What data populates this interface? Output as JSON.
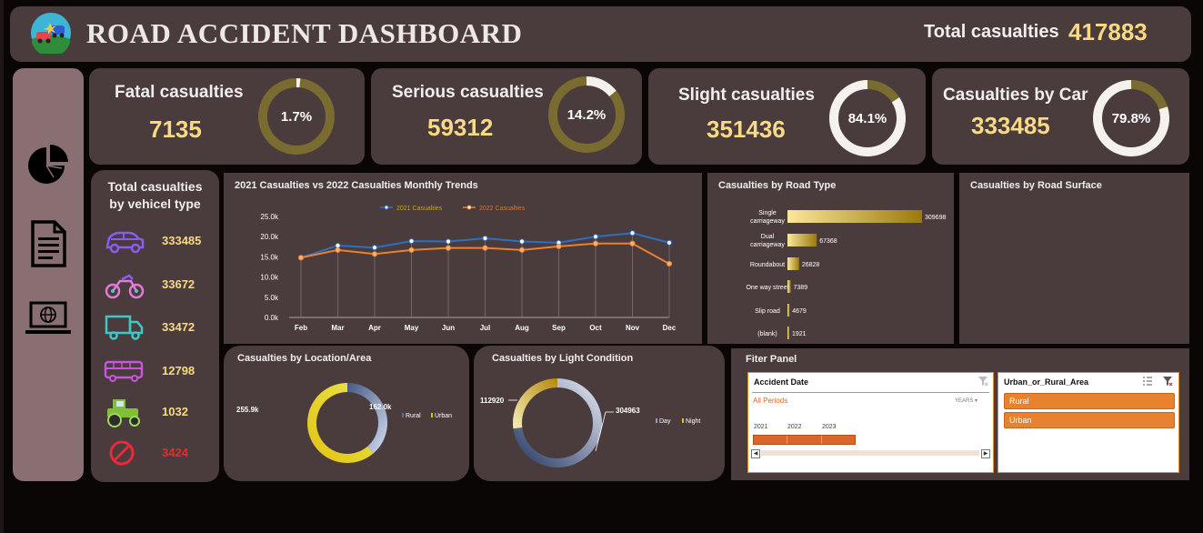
{
  "header": {
    "title": "ROAD ACCIDENT DASHBOARD",
    "total_label": "Total casualties",
    "total_value": "417883"
  },
  "sidebar": {
    "icons": [
      "pie-chart-icon",
      "document-icon",
      "laptop-globe-icon"
    ]
  },
  "kpis": [
    {
      "label": "Fatal casualties",
      "value": "7135",
      "pct_text": "1.7%",
      "pct": 1.7
    },
    {
      "label": "Serious casualties",
      "value": "59312",
      "pct_text": "14.2%",
      "pct": 14.2
    },
    {
      "label": "Slight casualties",
      "value": "351436",
      "pct_text": "84.1%",
      "pct": 84.1
    },
    {
      "label": "Casualties by Car",
      "value": "333485",
      "pct_text": "79.8%",
      "pct": 79.8
    }
  ],
  "vehicles": {
    "title_line1": "Total casualties",
    "title_line2": "by vehicel type",
    "items": [
      {
        "icon": "car-icon",
        "value": "333485"
      },
      {
        "icon": "motorcycle-icon",
        "value": "33672"
      },
      {
        "icon": "truck-icon",
        "value": "33472"
      },
      {
        "icon": "bus-icon",
        "value": "12798"
      },
      {
        "icon": "tractor-icon",
        "value": "1032"
      },
      {
        "icon": "prohibited-icon",
        "value": "3424"
      }
    ]
  },
  "trend": {
    "title": "2021 Casualties vs 2022 Casualties Monthly Trends"
  },
  "road_type": {
    "title": "Casualties by Road Type"
  },
  "road_surface": {
    "title": "Casualties by Road Surface"
  },
  "location": {
    "title": "Casualties by Location/Area"
  },
  "light": {
    "title": "Casualties by Light Condition"
  },
  "filter": {
    "title": "Fiter Panel",
    "date_slicer": {
      "header": "Accident Date",
      "all_periods": "All Periods",
      "years_label": "YEARS",
      "years": [
        "2021",
        "2022",
        "2023"
      ]
    },
    "area_slicer": {
      "header": "Urban_or_Rural_Area",
      "options": [
        "Rural",
        "Urban"
      ]
    }
  },
  "colors": {
    "panel": "#4a3b3d",
    "gold": "#f7d986",
    "ring": "#7a6c30",
    "line2021": "#2f6fbf",
    "line2022": "#e8822e",
    "orange": "#e8822e"
  },
  "chart_data": [
    {
      "type": "line",
      "title": "2021 Casualties vs 2022 Casualties Monthly Trends",
      "x": [
        "Feb",
        "Mar",
        "Apr",
        "May",
        "Jun",
        "Jul",
        "Aug",
        "Sep",
        "Oct",
        "Nov",
        "Dec"
      ],
      "ylim": [
        0,
        25000
      ],
      "yticks": [
        "0.0k",
        "5.0k",
        "10.0k",
        "15.0k",
        "20.0k",
        "25.0k"
      ],
      "grid": false,
      "legend": "top",
      "series": [
        {
          "name": "2021 Casualties",
          "values": [
            14800,
            17800,
            17300,
            18900,
            18800,
            19600,
            18800,
            18500,
            20000,
            20900,
            18500
          ]
        },
        {
          "name": "2022 Casualties",
          "values": [
            14800,
            16700,
            15700,
            16700,
            17200,
            17200,
            16700,
            17600,
            18300,
            18300,
            13300
          ]
        }
      ]
    },
    {
      "type": "bar",
      "orientation": "horizontal",
      "title": "Casualties by Road Type",
      "categories": [
        "Single carriageway",
        "Dual carriageway",
        "Roundabout",
        "One way street",
        "Slip road",
        "(blank)"
      ],
      "values": [
        309698,
        67368,
        26828,
        7389,
        4679,
        1921
      ],
      "labels": [
        "309698",
        "67368",
        "26828",
        "7389",
        "4679",
        "1921"
      ]
    },
    {
      "type": "pie",
      "variant": "donut",
      "title": "Casualties by Location/Area",
      "categories": [
        "Rural",
        "Urban"
      ],
      "values": [
        162.0,
        255.9
      ],
      "labels": [
        "162.0k",
        "255.9k"
      ]
    },
    {
      "type": "pie",
      "variant": "donut",
      "title": "Casualties by Light Condition",
      "categories": [
        "Day",
        "Night"
      ],
      "values": [
        304963,
        112920
      ],
      "labels": [
        "304963",
        "112920"
      ]
    }
  ]
}
